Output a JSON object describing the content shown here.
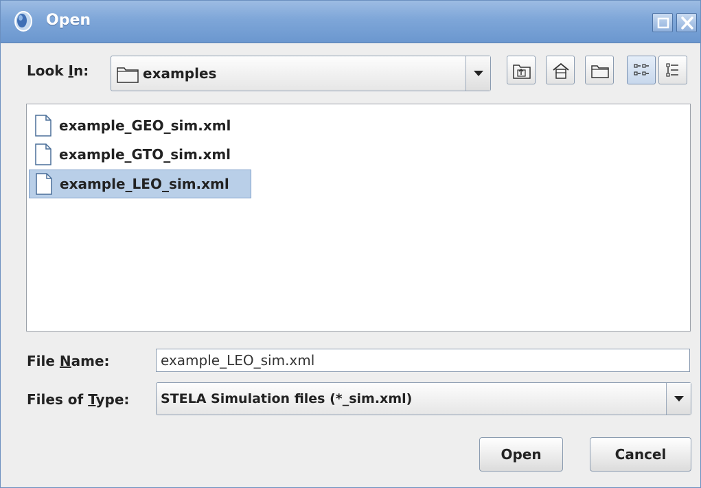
{
  "window": {
    "title": "Open",
    "icon": "app-globe-icon"
  },
  "look_in": {
    "label_pre": "Look ",
    "label_mnemonic": "I",
    "label_post": "n:",
    "value": "examples"
  },
  "toolbar": {
    "icons": [
      "up-one-level-icon",
      "home-icon",
      "new-folder-icon",
      "list-view-icon",
      "details-view-icon"
    ]
  },
  "files": [
    {
      "name": "example_GEO_sim.xml",
      "selected": false
    },
    {
      "name": "example_GTO_sim.xml",
      "selected": false
    },
    {
      "name": "example_LEO_sim.xml",
      "selected": true
    }
  ],
  "file_name": {
    "label_pre": "File ",
    "label_mnemonic": "N",
    "label_post": "ame:",
    "value": "example_LEO_sim.xml"
  },
  "file_type": {
    "label_pre": "Files of ",
    "label_mnemonic": "T",
    "label_post": "ype:",
    "value": "STELA Simulation files (*_sim.xml)"
  },
  "buttons": {
    "open": "Open",
    "cancel": "Cancel"
  },
  "colors": {
    "titlebar": "#7ea6d8",
    "selection": "#b9cfe8",
    "background": "#eeeeee"
  }
}
